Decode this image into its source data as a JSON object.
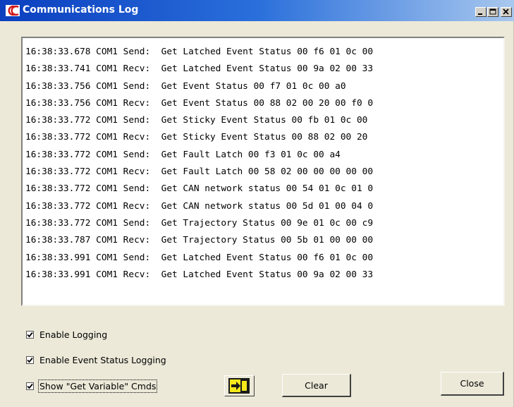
{
  "window": {
    "title": "Communications Log",
    "buttons": {
      "minimize": "_",
      "maximize": "□",
      "close": "×"
    }
  },
  "log": {
    "lines": [
      "16:38:33.678 COM1 Send:  Get Latched Event Status 00 f6 01 0c 00",
      "16:38:33.741 COM1 Recv:  Get Latched Event Status 00 9a 02 00 33",
      "16:38:33.756 COM1 Send:  Get Event Status 00 f7 01 0c 00 a0",
      "16:38:33.756 COM1 Recv:  Get Event Status 00 88 02 00 20 00 f0 0",
      "16:38:33.772 COM1 Send:  Get Sticky Event Status 00 fb 01 0c 00",
      "16:38:33.772 COM1 Recv:  Get Sticky Event Status 00 88 02 00 20",
      "16:38:33.772 COM1 Send:  Get Fault Latch 00 f3 01 0c 00 a4",
      "16:38:33.772 COM1 Recv:  Get Fault Latch 00 58 02 00 00 00 00 00",
      "16:38:33.772 COM1 Send:  Get CAN network status 00 54 01 0c 01 0",
      "16:38:33.772 COM1 Recv:  Get CAN network status 00 5d 01 00 04 0",
      "16:38:33.772 COM1 Send:  Get Trajectory Status 00 9e 01 0c 00 c9",
      "16:38:33.787 COM1 Recv:  Get Trajectory Status 00 5b 01 00 00 00",
      "16:38:33.991 COM1 Send:  Get Latched Event Status 00 f6 01 0c 00",
      "16:38:33.991 COM1 Recv:  Get Latched Event Status 00 9a 02 00 33"
    ]
  },
  "options": {
    "enable_logging": {
      "label": "Enable Logging",
      "checked": true
    },
    "enable_event_status_logging": {
      "label": "Enable Event Status Logging",
      "checked": true
    },
    "show_get_variable_cmds": {
      "label": "Show \"Get Variable\" Cmds",
      "checked": true
    }
  },
  "buttons": {
    "clear": "Clear",
    "close": "Close"
  },
  "colors": {
    "title_start": "#0b3fbf",
    "title_end": "#a8c8ee",
    "dialog_bg": "#ece9d8",
    "save_icon_yellow": "#f5e81a"
  },
  "icons": {
    "app": "logo-icon",
    "save_log": "save-log-icon"
  }
}
